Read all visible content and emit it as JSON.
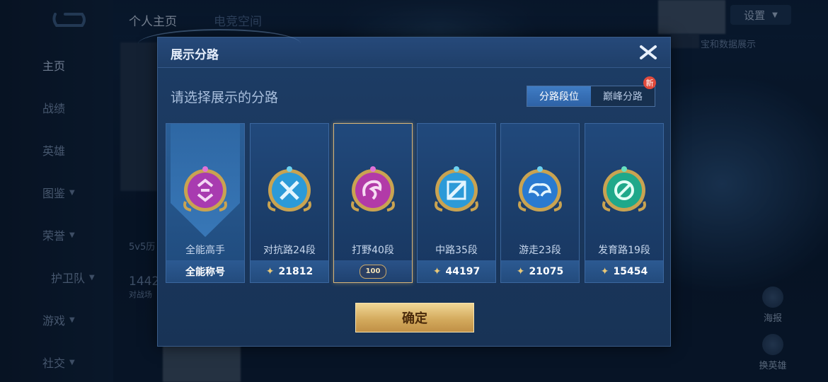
{
  "sidebar": {
    "items": [
      {
        "label": "主页",
        "active": true
      },
      {
        "label": "战绩"
      },
      {
        "label": "英雄"
      },
      {
        "label": "图鉴",
        "expandable": true
      },
      {
        "label": "荣誉",
        "expandable": true
      },
      {
        "label": "护卫队",
        "expandable": true
      },
      {
        "label": "游戏",
        "expandable": true
      },
      {
        "label": "社交",
        "expandable": true
      }
    ]
  },
  "topbar": {
    "tabs": [
      {
        "label": "个人主页"
      },
      {
        "label": "电竞空间"
      }
    ],
    "settings_label": "设置"
  },
  "background": {
    "right_text": "宝和数据展示",
    "mode_text": "5v5历",
    "stat_number": "1442",
    "stat_caption": "对战场",
    "poster_label": "海报",
    "change_hero_label": "换英雄"
  },
  "modal": {
    "title": "展示分路",
    "subtitle": "请选择展示的分路",
    "segments": [
      {
        "label": "分路段位",
        "active": true
      },
      {
        "label": "巅峰分路",
        "badge": "新"
      }
    ],
    "cards": [
      {
        "label": "全能高手",
        "footer_text": "全能称号",
        "emblem": "swirl",
        "color": "#a83bb0"
      },
      {
        "label": "对抗路24段",
        "score": "21812",
        "emblem": "crossed-swords",
        "color": "#2c9ad8"
      },
      {
        "label": "打野40段",
        "level": "100",
        "emblem": "dragon",
        "color": "#b23aa8",
        "selected": true
      },
      {
        "label": "中路35段",
        "score": "44197",
        "emblem": "wand",
        "color": "#2c9ad8"
      },
      {
        "label": "游走23段",
        "score": "21075",
        "emblem": "wings",
        "color": "#2a7ad0"
      },
      {
        "label": "发育路19段",
        "score": "15454",
        "emblem": "target",
        "color": "#1fa88a"
      }
    ],
    "confirm_label": "确定"
  },
  "colors": {
    "gold": "#d4ab5e",
    "selected_border": "#d8b578",
    "accent_blue": "#3f7cc4"
  }
}
